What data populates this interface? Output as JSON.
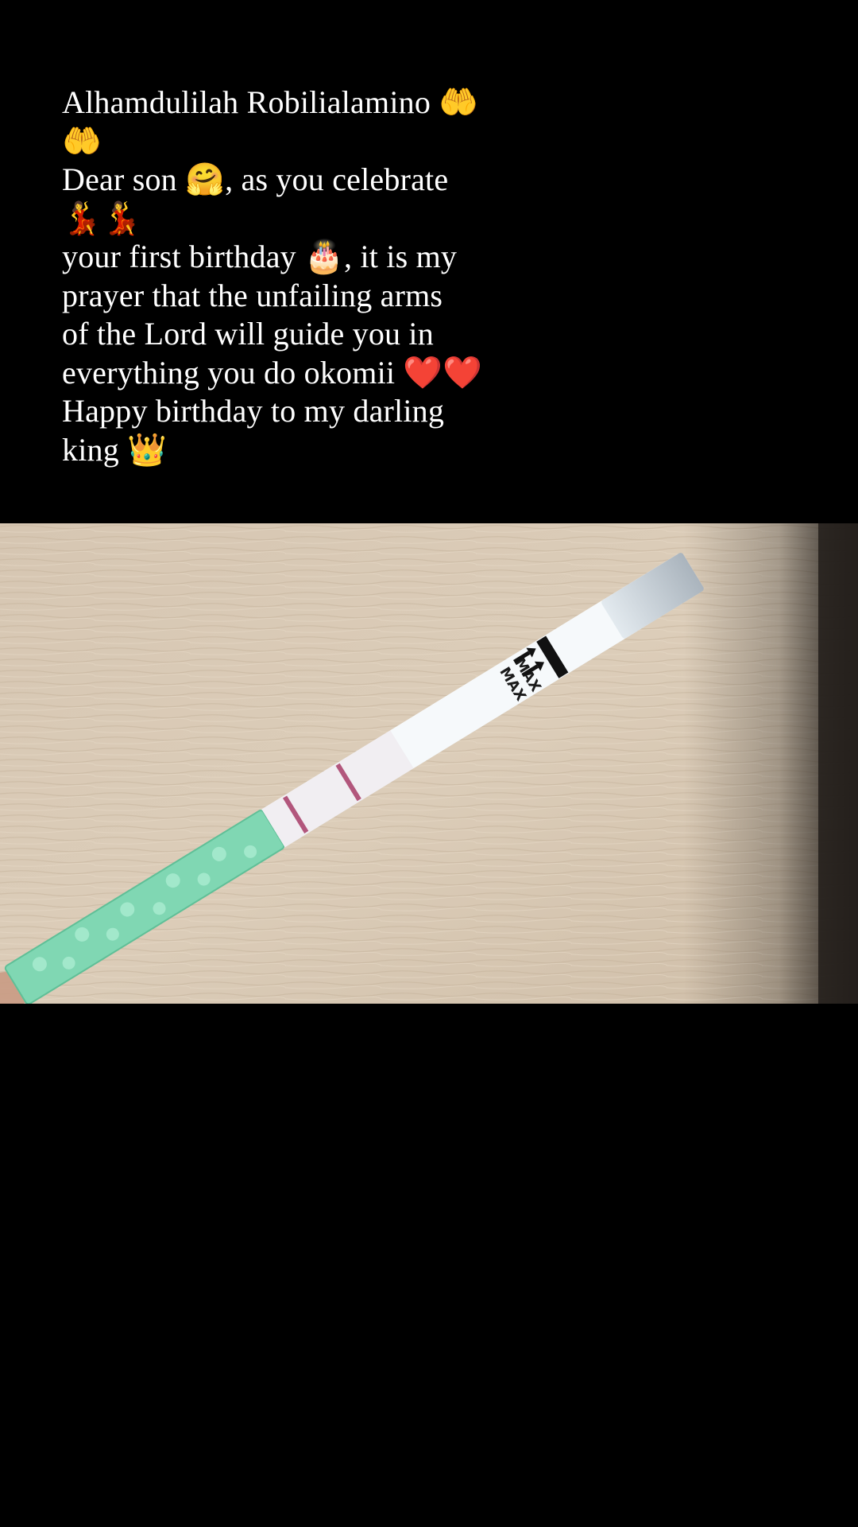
{
  "story": {
    "caption": "Alhamdulilah Robilialamino 🤲🤲\nDear son 🤗, as you celebrate 💃💃\nyour first birthday 🎂, it is my prayer that the unfailing arms\n of the Lord will guide you in everything you do okomii ❤️❤️\nHappy birthday to my darling king  👑"
  },
  "photo": {
    "subject": "pregnancy test strip on wooden surface",
    "strip_printed_text": [
      "MAX",
      "MAX"
    ],
    "colors": {
      "background": "#000000",
      "caption_text": "#ffffff",
      "wood": "#d8c8b4",
      "strip": "#eef2f4",
      "test_handle": "#7fd8b4",
      "test_line": "#b2567c"
    }
  }
}
